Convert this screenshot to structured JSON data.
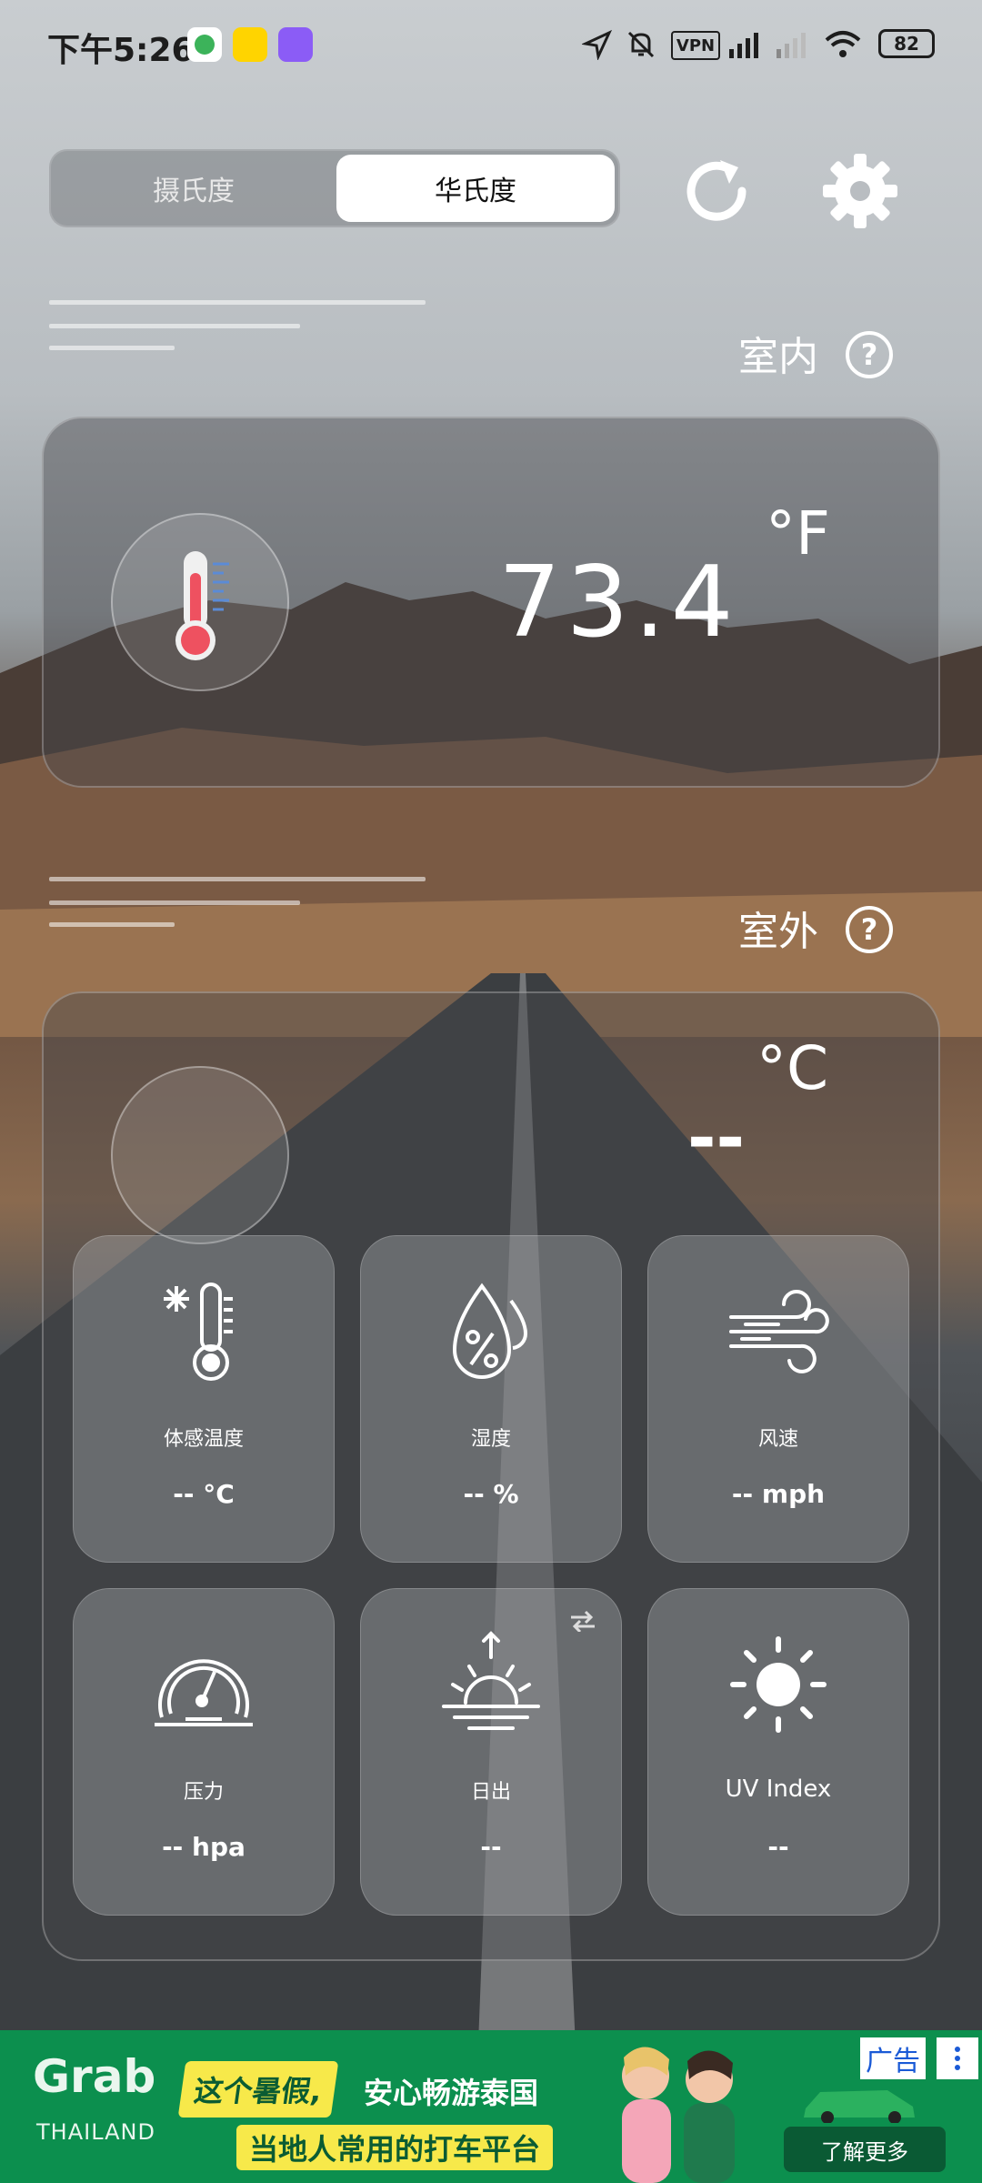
{
  "status_bar": {
    "time": "下午5:26",
    "vpn": "VPN",
    "battery": "82"
  },
  "unit_toggle": {
    "celsius_label": "摄氏度",
    "fahrenheit_label": "华氏度",
    "selected": "fahrenheit"
  },
  "indoor": {
    "label": "室内",
    "help": "?",
    "value": "73.4",
    "unit": "°F"
  },
  "outdoor": {
    "label": "室外",
    "help": "?",
    "value": "--",
    "unit": "°C"
  },
  "metrics": [
    {
      "icon": "feels-like-thermometer-icon",
      "label": "体感温度",
      "value": "-- °C"
    },
    {
      "icon": "humidity-drops-icon",
      "label": "湿度",
      "value": "-- %"
    },
    {
      "icon": "wind-icon",
      "label": "风速",
      "value": "-- mph"
    },
    {
      "icon": "gauge-icon",
      "label": "压力",
      "value": "-- hpa"
    },
    {
      "icon": "sunrise-icon",
      "label": "日出",
      "value": "--"
    },
    {
      "icon": "sun-icon",
      "label": "UV Index",
      "value": "--"
    }
  ],
  "ad": {
    "brand": "Grab",
    "brand_sub": "THAILAND",
    "headline_1": "这个暑假,",
    "headline_2": "安心畅游泰国",
    "headline_3": "当地人常用的打车平台",
    "cta": "了解更多",
    "tag": "广告"
  },
  "colors": {
    "accent": "#ffffff",
    "toggle_selected_bg": "#ffffff",
    "ad_bg": "#0c8f4e",
    "ad_highlight": "#f7e94a"
  }
}
